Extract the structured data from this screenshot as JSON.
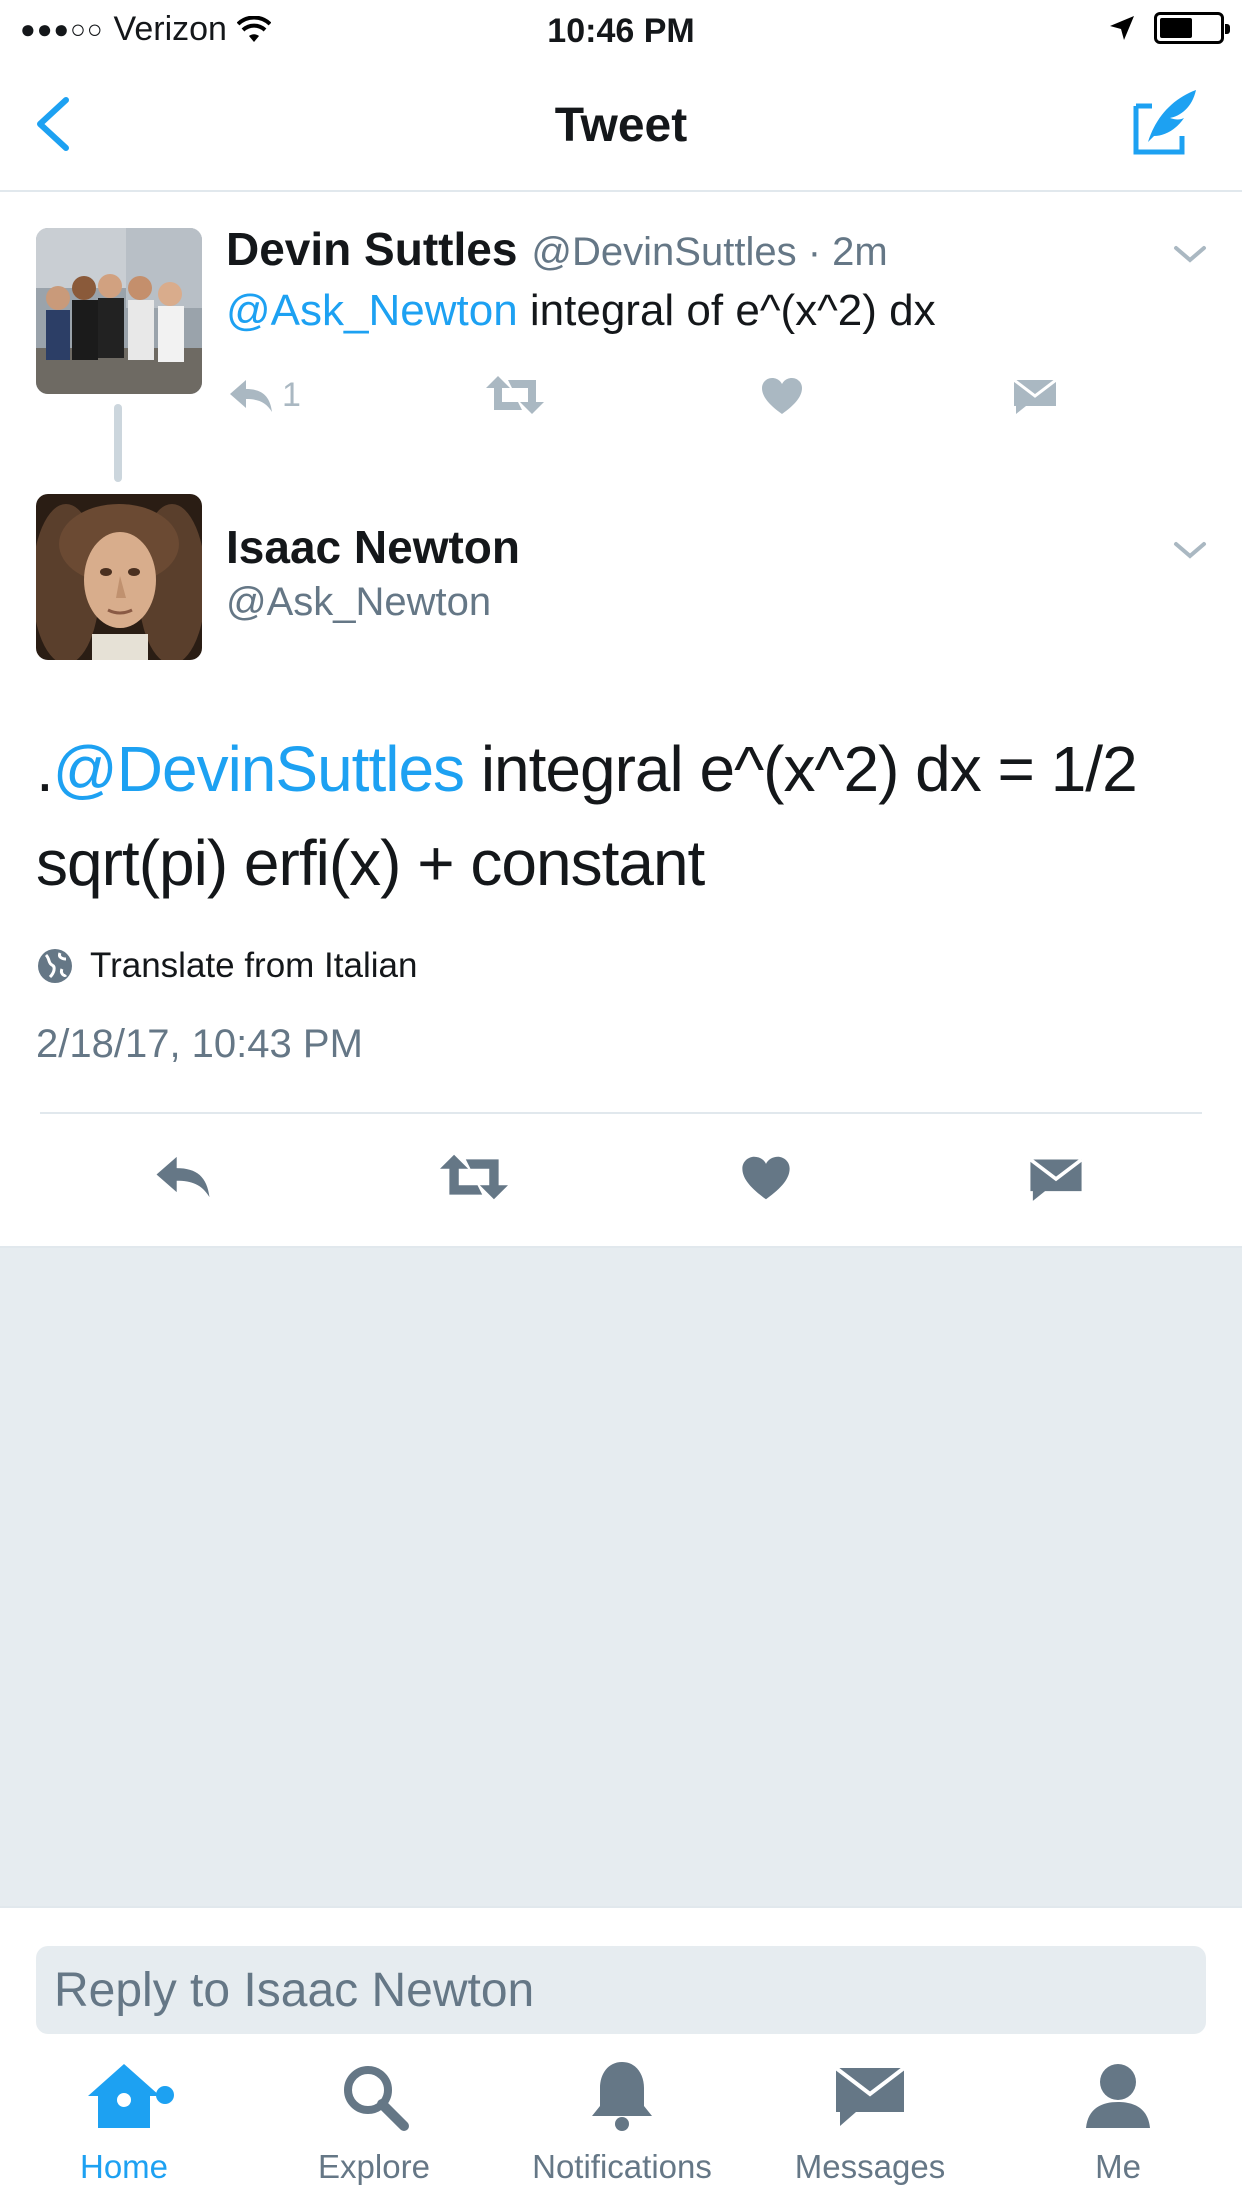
{
  "status_bar": {
    "carrier": "Verizon",
    "time": "10:46 PM"
  },
  "nav": {
    "title": "Tweet"
  },
  "parent_tweet": {
    "name": "Devin Suttles",
    "handle": "@DevinSuttles",
    "separator": "·",
    "time_ago": "2m",
    "mention": "@Ask_Newton",
    "text": " integral of e^(x^2) dx",
    "reply_count": "1"
  },
  "main_tweet": {
    "name": "Isaac Newton",
    "handle": "@Ask_Newton",
    "text_prefix": ".",
    "mention": "@DevinSuttles",
    "text": " integral e^(x^2)  dx = 1/2 sqrt(pi) erfi(x) + constant",
    "translate_label": "Translate from Italian",
    "timestamp": "2/18/17, 10:43 PM"
  },
  "reply": {
    "placeholder": "Reply to Isaac Newton"
  },
  "tabs": [
    {
      "label": "Home",
      "icon": "home-icon",
      "active": true
    },
    {
      "label": "Explore",
      "icon": "search-icon",
      "active": false
    },
    {
      "label": "Notifications",
      "icon": "bell-icon",
      "active": false
    },
    {
      "label": "Messages",
      "icon": "envelope-icon",
      "active": false
    },
    {
      "label": "Me",
      "icon": "person-icon",
      "active": false
    }
  ],
  "colors": {
    "accent": "#1da1f2",
    "secondary_text": "#657786",
    "background_gray": "#e6ecf0"
  }
}
